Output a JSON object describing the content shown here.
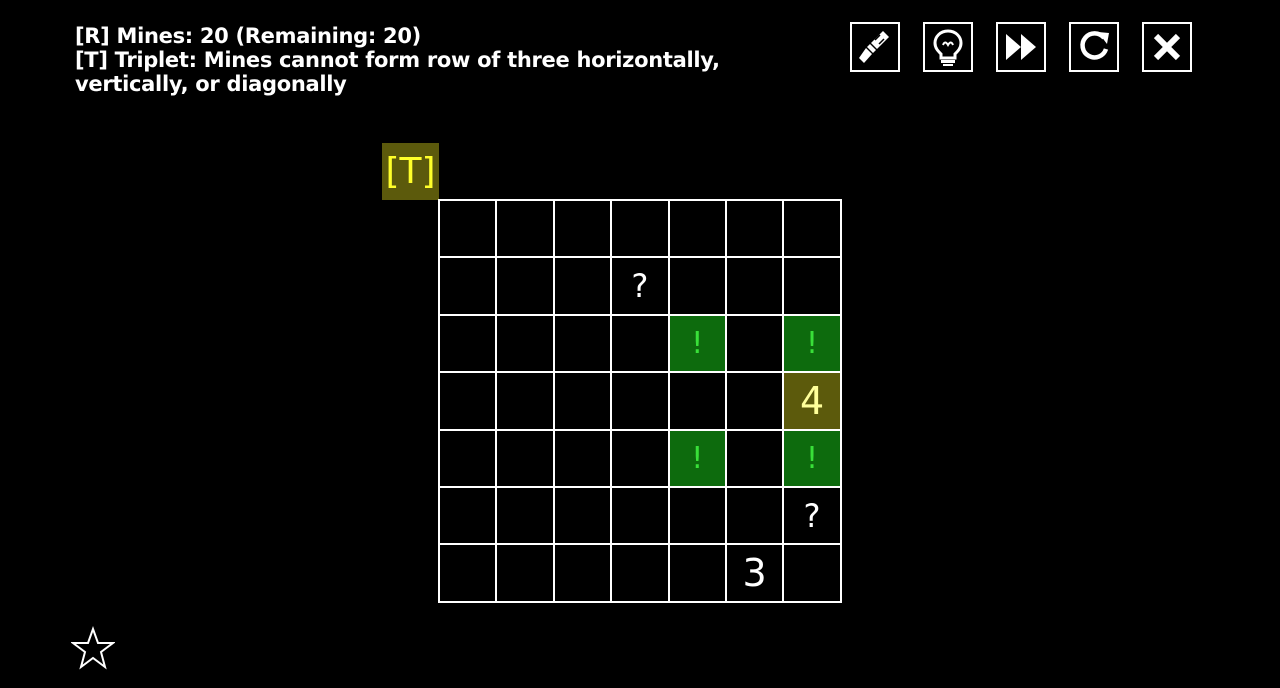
{
  "rules": {
    "line1": "[R] Mines: 20 (Remaining: 20)",
    "line2": "[T] Triplet: Mines cannot form row of three horizontally,",
    "line3": "vertically, or diagonally"
  },
  "rule_tag": "[T]",
  "toolbar": {
    "buttons": [
      "brush-icon",
      "lightbulb-icon",
      "fast-forward-icon",
      "restart-icon",
      "close-icon"
    ]
  },
  "board": {
    "rows": 7,
    "cols": 7,
    "cells": [
      [
        "",
        "",
        "",
        "",
        "",
        "",
        ""
      ],
      [
        "",
        "",
        "",
        "?",
        "",
        "",
        ""
      ],
      [
        "",
        "",
        "",
        "",
        "!",
        "",
        "!"
      ],
      [
        "",
        "",
        "",
        "",
        "",
        "",
        "4"
      ],
      [
        "",
        "",
        "",
        "",
        "!",
        "",
        "!"
      ],
      [
        "",
        "",
        "",
        "",
        "",
        "",
        "?"
      ],
      [
        "",
        "",
        "",
        "",
        "",
        "3",
        ""
      ]
    ],
    "highlighted": [
      [
        3,
        6
      ]
    ],
    "colors": {
      "flag_bg": "#0d6b0d",
      "flag_text": "#39e039",
      "highlight_bg": "#5c5a0c",
      "highlight_text": "#ffff9a",
      "tag_text": "#ffff2a"
    }
  },
  "star_icon": "star-outline-icon"
}
